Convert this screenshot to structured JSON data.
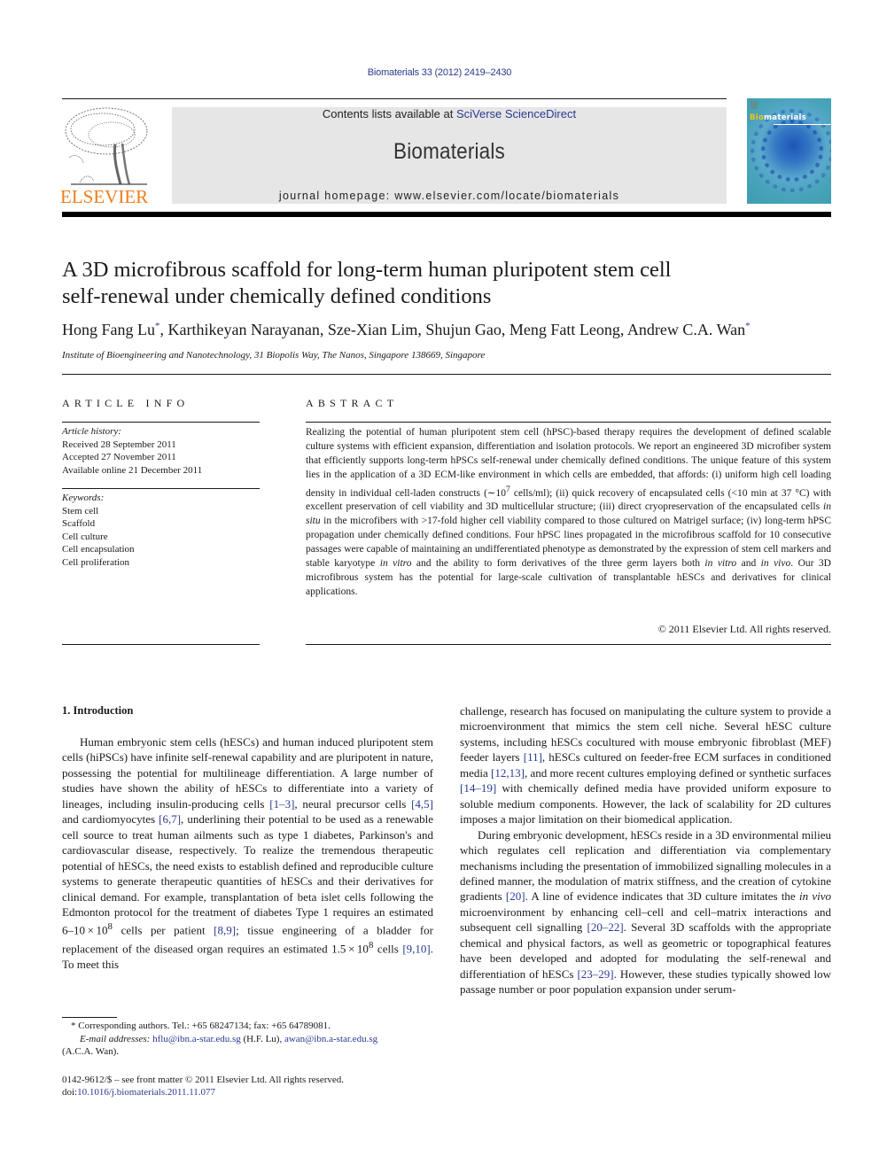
{
  "header": {
    "citation": "Biomaterials 33 (2012) 2419–2430",
    "contents_prefix": "Contents lists available at ",
    "contents_link": "SciVerse ScienceDirect",
    "journal_name": "Biomaterials",
    "homepage_label": "journal homepage: ",
    "homepage_url": "www.elsevier.com/locate/biomaterials",
    "publisher_logo": "ELSEVIER",
    "cover_title_highlight": "Bio",
    "cover_title_rest": "materials",
    "colors": {
      "link": "#2a3a8f",
      "elsevier_orange": "#f07d1a",
      "banner_bg": "#e6e6e6"
    }
  },
  "article": {
    "title_line1": "A 3D microfibrous scaffold for long-term human pluripotent stem cell",
    "title_line2": "self-renewal under chemically defined conditions",
    "authors": [
      {
        "name": "Hong Fang Lu",
        "mark": "*",
        "sep": ", "
      },
      {
        "name": "Karthikeyan Narayanan",
        "mark": "",
        "sep": ", "
      },
      {
        "name": "Sze-Xian Lim",
        "mark": "",
        "sep": ", "
      },
      {
        "name": "Shujun Gao",
        "mark": "",
        "sep": ", "
      },
      {
        "name": "Meng Fatt Leong",
        "mark": "",
        "sep": ", "
      },
      {
        "name": "Andrew C.A. Wan",
        "mark": "*",
        "sep": ""
      }
    ],
    "affiliation": "Institute of Bioengineering and Nanotechnology, 31 Biopolis Way, The Nanos, Singapore 138669, Singapore"
  },
  "article_info": {
    "heading": "ARTICLE INFO",
    "history_label": "Article history:",
    "received": "Received 28 September 2011",
    "accepted": "Accepted 27 November 2011",
    "online": "Available online 21 December 2011",
    "keywords_label": "Keywords:",
    "keywords": [
      "Stem cell",
      "Scaffold",
      "Cell culture",
      "Cell encapsulation",
      "Cell proliferation"
    ]
  },
  "abstract": {
    "heading": "ABSTRACT",
    "p1": "Realizing the potential of human pluripotent stem cell (hPSC)-based therapy requires the development of defined scalable culture systems with efficient expansion, differentiation and isolation protocols. We report an engineered 3D microfiber system that efficiently supports long-term hPSCs self-renewal under chemically defined conditions. The unique feature of this system lies in the application of a 3D ECM-like environment in which cells are embedded, that affords: (i) uniform high cell loading density in individual cell-laden constructs (∼10",
    "sup1": "7",
    "p2": " cells/ml); (ii) quick recovery of encapsulated cells (<10 min at 37 °C) with excellent preservation of cell viability and 3D multicellular structure; (iii) direct cryopreservation of the encapsulated cells ",
    "i1": "in situ",
    "p3": " in the microfibers with >17-fold higher cell viability compared to those cultured on Matrigel surface; (iv) long-term hPSC propagation under chemically defined conditions. Four hPSC lines propagated in the microfibrous scaffold for 10 consecutive passages were capable of maintaining an undifferentiated phenotype as demonstrated by the expression of stem cell markers and stable karyotype ",
    "i2": "in vitro",
    "p4": " and the ability to form derivatives of the three germ layers both ",
    "i3": "in vitro",
    "p5": " and ",
    "i4": "in vivo",
    "p6": ". Our 3D microfibrous system has the potential for large-scale cultivation of transplantable hESCs and derivatives for clinical applications.",
    "copyright": "© 2011 Elsevier Ltd. All rights reserved."
  },
  "body": {
    "section_title": "1.  Introduction",
    "left": {
      "s1": "Human embryonic stem cells (hESCs) and human induced pluripotent stem cells (hiPSCs) have infinite self-renewal capability and are pluripotent in nature, possessing the potential for multilineage differentiation. A large number of studies have shown the ability of hESCs to differentiate into a variety of lineages, including insulin-producing cells ",
      "r1": "[1–3]",
      "s2": ", neural precursor cells ",
      "r2": "[4,5]",
      "s3": " and cardiomyocytes ",
      "r3": "[6,7]",
      "s4": ", underlining their potential to be used as a renewable cell source to treat human ailments such as type 1 diabetes, Parkinson's and cardiovascular disease, respectively. To realize the tremendous therapeutic potential of hESCs, the need exists to establish defined and reproducible culture systems to generate therapeutic quantities of hESCs and their derivatives for clinical demand. For example, transplantation of beta islet cells following the Edmonton protocol for the treatment of diabetes Type 1 requires an estimated 6–10 × 10",
      "sup1": "8",
      "s5": " cells per patient ",
      "r4": "[8,9]",
      "s6": "; tissue engineering of a bladder for replacement of the diseased organ requires an estimated 1.5 × 10",
      "sup2": "8",
      "s7": " cells ",
      "r5": "[9,10]",
      "s8": ". To meet this"
    },
    "right": {
      "p1a": "challenge, research has focused on manipulating the culture system to provide a microenvironment that mimics the stem cell niche. Several hESC culture systems, including hESCs cocultured with mouse embryonic fibroblast (MEF) feeder layers ",
      "r1": "[11]",
      "p1b": ", hESCs cultured on feeder-free ECM surfaces in conditioned media ",
      "r2": "[12,13]",
      "p1c": ", and more recent cultures employing defined or synthetic surfaces ",
      "r3": "[14–19]",
      "p1d": " with chemically defined media have provided uniform exposure to soluble medium components. However, the lack of scalability for 2D cultures imposes a major limitation on their biomedical application.",
      "p2a": "During embryonic development, hESCs reside in a 3D environmental milieu which regulates cell replication and differentiation via complementary mechanisms including the presentation of immobilized signalling molecules in a defined manner, the modulation of matrix stiffness, and the creation of cytokine gradients ",
      "r4": "[20]",
      "p2b": ". A line of evidence indicates that 3D culture imitates the ",
      "i1": "in vivo",
      "p2c": " microenvironment by enhancing cell–cell and cell–matrix interactions and subsequent cell signalling ",
      "r5": "[20–22]",
      "p2d": ". Several 3D scaffolds with the appropriate chemical and physical factors, as well as geometric or topographical features have been developed and adopted for modulating the self-renewal and differentiation of hESCs ",
      "r6": "[23–29]",
      "p2e": ". However, these studies typically showed low passage number or poor population expansion under serum-"
    }
  },
  "footnotes": {
    "corr": "* Corresponding authors. Tel.: +65 68247134; fax: +65 64789081.",
    "email_label": "E-mail addresses:",
    "email1": "hflu@ibn.a-star.edu.sg",
    "email1_owner": " (H.F. Lu), ",
    "email2": "awan@ibn.a-star.edu.sg",
    "email2_owner": "(A.C.A. Wan).",
    "issn": "0142-9612/$ – see front matter © 2011 Elsevier Ltd. All rights reserved.",
    "doi_label": "doi:",
    "doi": "10.1016/j.biomaterials.2011.11.077"
  }
}
